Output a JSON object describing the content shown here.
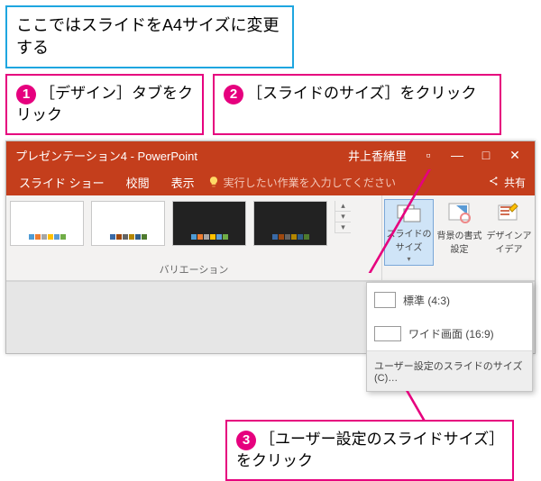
{
  "intro": "ここではスライドをA4サイズに変更する",
  "steps": {
    "s1": {
      "num": "1",
      "text": "［デザイン］タブをクリック"
    },
    "s2": {
      "num": "2",
      "text": "［スライドのサイズ］をクリック"
    },
    "s3": {
      "num": "3",
      "text": "［ユーザー設定のスライドサイズ］をクリック"
    }
  },
  "app": {
    "title": "プレゼンテーション4 - PowerPoint",
    "user": "井上香緒里",
    "tabs": {
      "slideshow": "スライド ショー",
      "review": "校閲",
      "view": "表示"
    },
    "tellme": "実行したい作業を入力してください",
    "share": "共有",
    "variations_label": "バリエーション",
    "group": {
      "slidesize": "スライドのサイズ",
      "background": "背景の書式設定",
      "ideas": "デザインアイデア"
    },
    "dropdown": {
      "standard": "標準 (4:3)",
      "wide": "ワイド画面 (16:9)",
      "custom": "ユーザー設定のスライドのサイズ(C)…"
    }
  },
  "palette": [
    "#4e9bd4",
    "#ed7d31",
    "#a5a5a5",
    "#ffc000",
    "#5b9bd5",
    "#70ad47",
    "#3a6aa6",
    "#9e480e"
  ]
}
